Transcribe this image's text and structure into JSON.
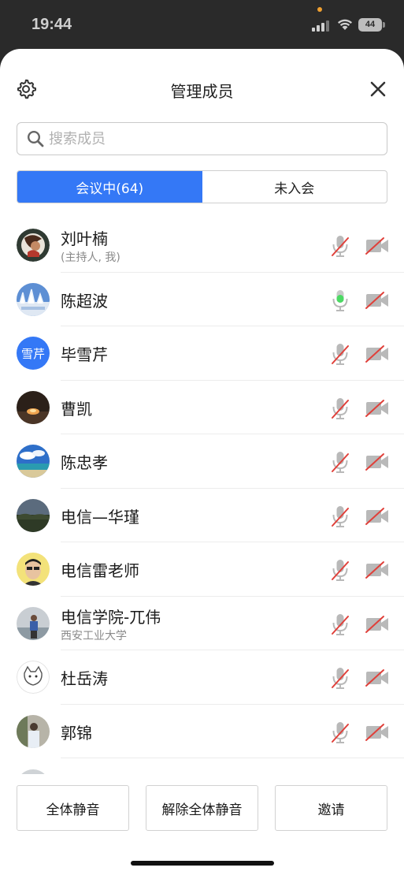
{
  "status_bar": {
    "time": "19:44",
    "battery": "44"
  },
  "header": {
    "title": "管理成员",
    "settings_icon": "gear-icon",
    "close_icon": "close-icon"
  },
  "search": {
    "placeholder": "搜索成员",
    "value": ""
  },
  "tabs": [
    {
      "label": "会议中(64)",
      "active": true
    },
    {
      "label": "未入会",
      "active": false
    }
  ],
  "members": [
    {
      "name": "刘叶楠",
      "subtitle": "(主持人, 我)",
      "mic": "muted",
      "camera": "off"
    },
    {
      "name": "陈超波",
      "subtitle": "",
      "mic": "active",
      "camera": "off"
    },
    {
      "name": "毕雪芹",
      "subtitle": "",
      "avatar_text": "雪芹",
      "mic": "muted",
      "camera": "off"
    },
    {
      "name": "曹凯",
      "subtitle": "",
      "mic": "muted",
      "camera": "off"
    },
    {
      "name": "陈忠孝",
      "subtitle": "",
      "mic": "muted",
      "camera": "off"
    },
    {
      "name": "电信—华瑾",
      "subtitle": "",
      "mic": "muted",
      "camera": "off"
    },
    {
      "name": "电信雷老师",
      "subtitle": "",
      "mic": "muted",
      "camera": "off"
    },
    {
      "name": "电信学院-兀伟",
      "subtitle": "西安工业大学",
      "mic": "muted",
      "camera": "off"
    },
    {
      "name": "杜岳涛",
      "subtitle": "",
      "mic": "muted",
      "camera": "off"
    },
    {
      "name": "郭锦",
      "subtitle": "",
      "mic": "muted",
      "camera": "off"
    }
  ],
  "footer": {
    "mute_all": "全体静音",
    "unmute_all": "解除全体静音",
    "invite": "邀请"
  },
  "colors": {
    "accent": "#3478f6",
    "muted_red": "#e0403a",
    "mic_active": "#4cd964"
  }
}
